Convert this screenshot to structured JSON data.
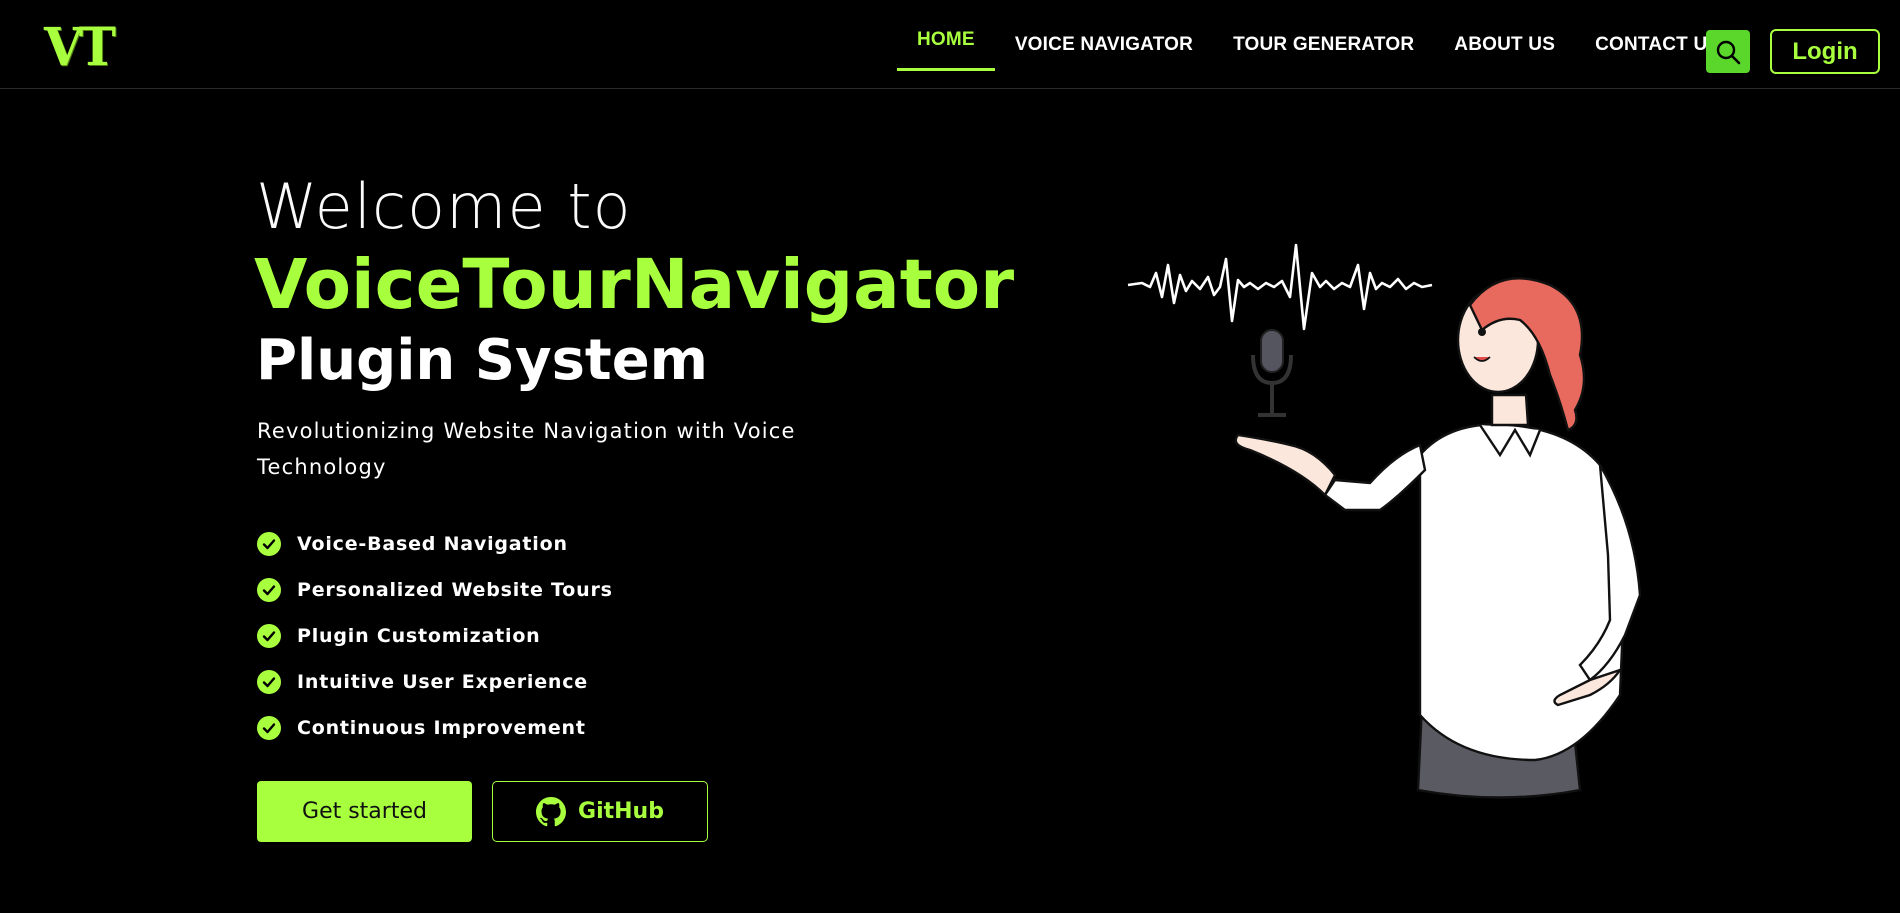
{
  "nav": {
    "logo_text": "VT",
    "links": [
      {
        "label": "HOME",
        "active": true
      },
      {
        "label": "VOICE NAVIGATOR",
        "active": false
      },
      {
        "label": "TOUR GENERATOR",
        "active": false
      },
      {
        "label": "ABOUT US",
        "active": false
      },
      {
        "label": "CONTACT US",
        "active": false
      }
    ],
    "search_icon": "search-icon",
    "login_label": "Login"
  },
  "hero": {
    "welcome": "Welcome to",
    "brand": "VoiceTourNavigator",
    "plugin": "Plugin System",
    "subtitle": "Revolutionizing Website Navigation with Voice Technology",
    "features": [
      "Voice-Based Navigation",
      "Personalized Website Tours",
      "Plugin Customization",
      "Intuitive User Experience",
      "Continuous Improvement"
    ],
    "get_started_label": "Get started",
    "github_label": "GitHub",
    "github_icon": "github-icon"
  },
  "colors": {
    "accent": "#a8ff3e",
    "search_bg": "#5bd62a",
    "background": "#000000"
  }
}
